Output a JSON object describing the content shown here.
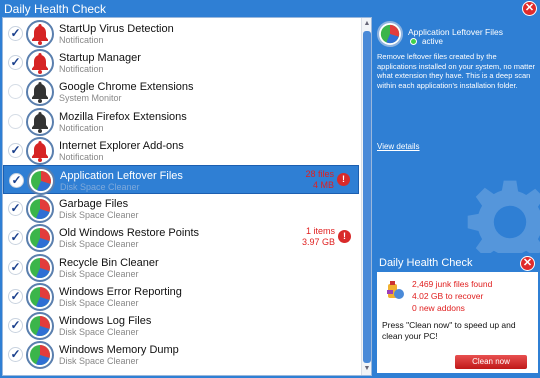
{
  "app": {
    "title": "Daily Health Check"
  },
  "items": [
    {
      "name": "StartUp Virus Detection",
      "category": "Notification",
      "checked": true,
      "icon": "bell-red-icon"
    },
    {
      "name": "Startup Manager",
      "category": "Notification",
      "checked": true,
      "icon": "bell-red-icon"
    },
    {
      "name": "Google Chrome Extensions",
      "category": "System Monitor",
      "checked": false,
      "icon": "bell-dark-icon"
    },
    {
      "name": "Mozilla Firefox Extensions",
      "category": "Notification",
      "checked": false,
      "icon": "bell-dark-icon"
    },
    {
      "name": "Internet Explorer Add-ons",
      "category": "Notification",
      "checked": true,
      "icon": "bell-red-icon"
    },
    {
      "name": "Application Leftover Files",
      "category": "Disk Space Cleaner",
      "checked": true,
      "icon": "pie-chart-icon",
      "selected": true,
      "stat1": "28 files",
      "stat2": "4 MB",
      "warning": true
    },
    {
      "name": "Garbage Files",
      "category": "Disk Space Cleaner",
      "checked": true,
      "icon": "pie-chart-icon"
    },
    {
      "name": "Old Windows Restore Points",
      "category": "Disk Space Cleaner",
      "checked": true,
      "icon": "pie-chart-icon",
      "stat1": "1 items",
      "stat2": "3.97 GB",
      "warning": true
    },
    {
      "name": "Recycle Bin Cleaner",
      "category": "Disk Space Cleaner",
      "checked": true,
      "icon": "pie-chart-icon"
    },
    {
      "name": "Windows Error Reporting",
      "category": "Disk Space Cleaner",
      "checked": true,
      "icon": "pie-chart-icon"
    },
    {
      "name": "Windows Log Files",
      "category": "Disk Space Cleaner",
      "checked": true,
      "icon": "pie-chart-icon"
    },
    {
      "name": "Windows Memory Dump",
      "category": "Disk Space Cleaner",
      "checked": true,
      "icon": "pie-chart-icon"
    }
  ],
  "detail": {
    "title": "Application Leftover Files",
    "status": "active",
    "description": "Remove leftover files created by the applications installed on your system, no matter what extension they have. This is a deep scan within each application's installation folder.",
    "link": "View details"
  },
  "popup": {
    "title": "Daily Health Check",
    "junk": "2,469 junk files found",
    "recover": "4.02 GB to recover",
    "addons": "0 new addons",
    "message": "Press \"Clean now\" to speed up and clean your PC!",
    "button": "Clean now"
  },
  "colors": {
    "accent": "#2f7fd4",
    "alert": "#e02020",
    "active": "#3fd14a"
  }
}
